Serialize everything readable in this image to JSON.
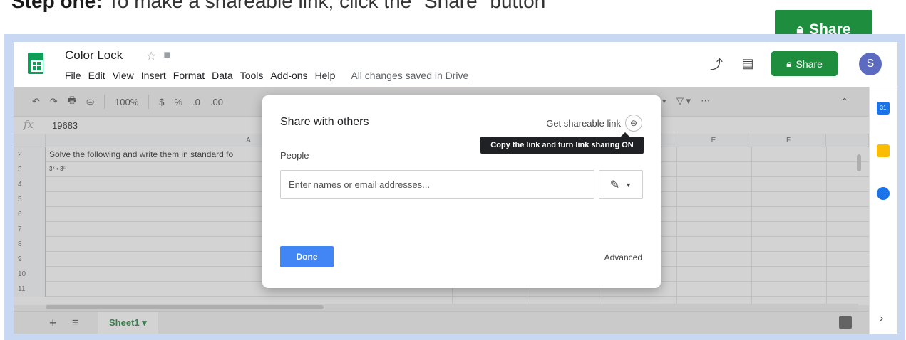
{
  "caption": {
    "bold": "Step one:",
    "rest": " To make a shareable link, click the \"Share\" button"
  },
  "callout": {
    "share_label": "Share",
    "lock_icon": "lock-icon"
  },
  "app": {
    "title": "Color Lock",
    "menu": [
      "File",
      "Edit",
      "View",
      "Insert",
      "Format",
      "Data",
      "Tools",
      "Add-ons",
      "Help"
    ],
    "saved_status": "All changes saved in Drive",
    "share_label": "Share",
    "avatar_initial": "S",
    "brand_green": "#1e8e3e"
  },
  "toolbar": {
    "undo": "↶",
    "redo": "↷",
    "print": "🖶",
    "paint": "⛀",
    "zoom": "100%",
    "currency": "$",
    "percent": "%",
    "dec_less": ".0",
    "dec_more": ".00",
    "more": "⋯",
    "collapse": "⌃"
  },
  "formula": {
    "fx": "fx",
    "value": "19683"
  },
  "grid": {
    "columns": [
      "A",
      "E",
      "F"
    ],
    "rows": [
      {
        "num": "2",
        "text": "Solve the following and write them in standard fo"
      },
      {
        "num": "3",
        "text": "3⁴ • 3⁵"
      },
      {
        "num": "4",
        "text": ""
      },
      {
        "num": "5",
        "text": ""
      },
      {
        "num": "6",
        "text": ""
      },
      {
        "num": "7",
        "text": ""
      },
      {
        "num": "8",
        "text": ""
      },
      {
        "num": "9",
        "text": ""
      },
      {
        "num": "10",
        "text": ""
      },
      {
        "num": "11",
        "text": ""
      }
    ]
  },
  "sheets": {
    "add": "+",
    "list": "≡",
    "active_tab": "Sheet1 ▾"
  },
  "sidepanel": {
    "calendar_day": "31",
    "expand": "›"
  },
  "dialog": {
    "title": "Share with others",
    "get_link": "Get shareable link",
    "tooltip": "Copy the link and turn link sharing ON",
    "people_label": "People",
    "input_placeholder": "Enter names or email addresses...",
    "done": "Done",
    "advanced": "Advanced"
  }
}
